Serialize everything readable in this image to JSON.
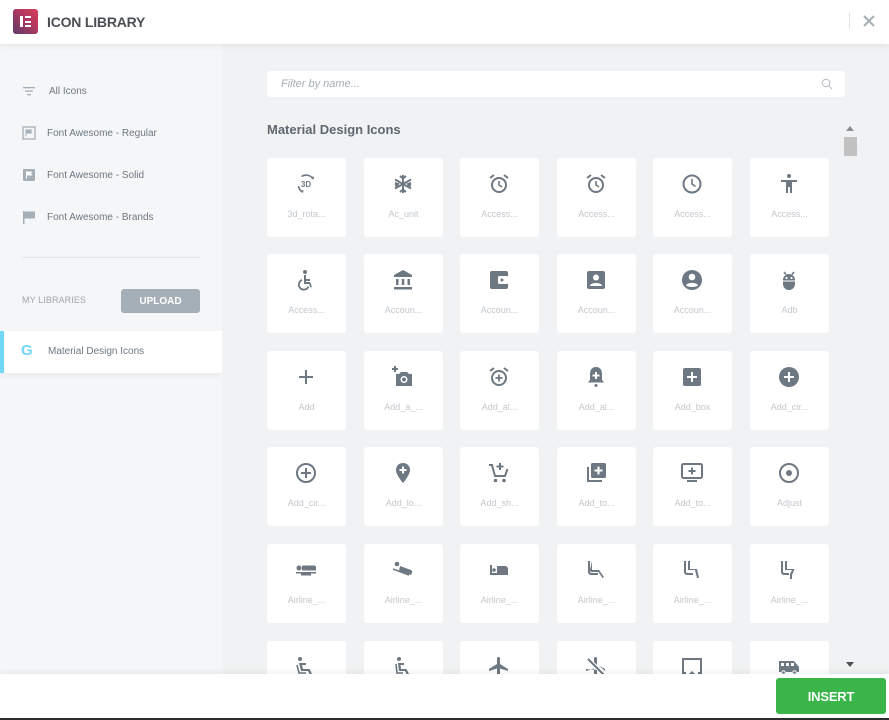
{
  "header": {
    "title": "ICON LIBRARY",
    "brand_color": "#b5375e"
  },
  "sidebar": {
    "items": [
      {
        "label": "All Icons",
        "icon": "filter-lines-icon"
      },
      {
        "label": "Font Awesome - Regular",
        "icon": "flag-regular-icon"
      },
      {
        "label": "Font Awesome - Solid",
        "icon": "flag-solid-icon"
      },
      {
        "label": "Font Awesome - Brands",
        "icon": "flag-brands-icon"
      }
    ],
    "my_libraries_label": "MY LIBRARIES",
    "upload_label": "UPLOAD",
    "library": {
      "label": "Material Design Icons",
      "icon": "google-g-icon",
      "accent": "#71d7f7"
    }
  },
  "main": {
    "search_placeholder": "Filter by name...",
    "search_value": "",
    "section_title": "Material Design Icons",
    "icons": [
      {
        "name": "3d_rota...",
        "icon": "3d-rotation-icon"
      },
      {
        "name": "Ac_unit",
        "icon": "ac-unit-icon"
      },
      {
        "name": "Access...",
        "icon": "access-alarm-icon"
      },
      {
        "name": "Access...",
        "icon": "access-alarms-icon"
      },
      {
        "name": "Access...",
        "icon": "access-time-icon"
      },
      {
        "name": "Access...",
        "icon": "accessibility-icon"
      },
      {
        "name": "Access...",
        "icon": "accessible-icon"
      },
      {
        "name": "Accoun...",
        "icon": "account-balance-icon"
      },
      {
        "name": "Accoun...",
        "icon": "account-balance-wallet-icon"
      },
      {
        "name": "Accoun...",
        "icon": "account-box-icon"
      },
      {
        "name": "Accoun...",
        "icon": "account-circle-icon"
      },
      {
        "name": "Adb",
        "icon": "adb-icon"
      },
      {
        "name": "Add",
        "icon": "add-icon"
      },
      {
        "name": "Add_a_...",
        "icon": "add-a-photo-icon"
      },
      {
        "name": "Add_al...",
        "icon": "add-alarm-icon"
      },
      {
        "name": "Add_al...",
        "icon": "add-alert-icon"
      },
      {
        "name": "Add_box",
        "icon": "add-box-icon"
      },
      {
        "name": "Add_cir...",
        "icon": "add-circle-icon"
      },
      {
        "name": "Add_cir...",
        "icon": "add-circle-outline-icon"
      },
      {
        "name": "Add_lo...",
        "icon": "add-location-icon"
      },
      {
        "name": "Add_sh...",
        "icon": "add-shopping-cart-icon"
      },
      {
        "name": "Add_to...",
        "icon": "add-to-photos-icon"
      },
      {
        "name": "Add_to...",
        "icon": "add-to-queue-icon"
      },
      {
        "name": "Adjust",
        "icon": "adjust-icon"
      },
      {
        "name": "Airline_...",
        "icon": "airline-seat-flat-icon"
      },
      {
        "name": "Airline_...",
        "icon": "airline-seat-flat-angled-icon"
      },
      {
        "name": "Airline_...",
        "icon": "airline-seat-individual-suite-icon"
      },
      {
        "name": "Airline_...",
        "icon": "airline-seat-legroom-extra-icon"
      },
      {
        "name": "Airline_...",
        "icon": "airline-seat-legroom-normal-icon"
      },
      {
        "name": "Airline_...",
        "icon": "airline-seat-legroom-reduced-icon"
      },
      {
        "name": "",
        "icon": "airline-seat-recline-extra-icon"
      },
      {
        "name": "",
        "icon": "airline-seat-recline-normal-icon"
      },
      {
        "name": "",
        "icon": "airplanemode-active-icon"
      },
      {
        "name": "",
        "icon": "airplanemode-inactive-icon"
      },
      {
        "name": "",
        "icon": "airplay-icon"
      },
      {
        "name": "",
        "icon": "airport-shuttle-icon"
      }
    ]
  },
  "footer": {
    "insert_label": "INSERT",
    "insert_color": "#39b54a"
  }
}
